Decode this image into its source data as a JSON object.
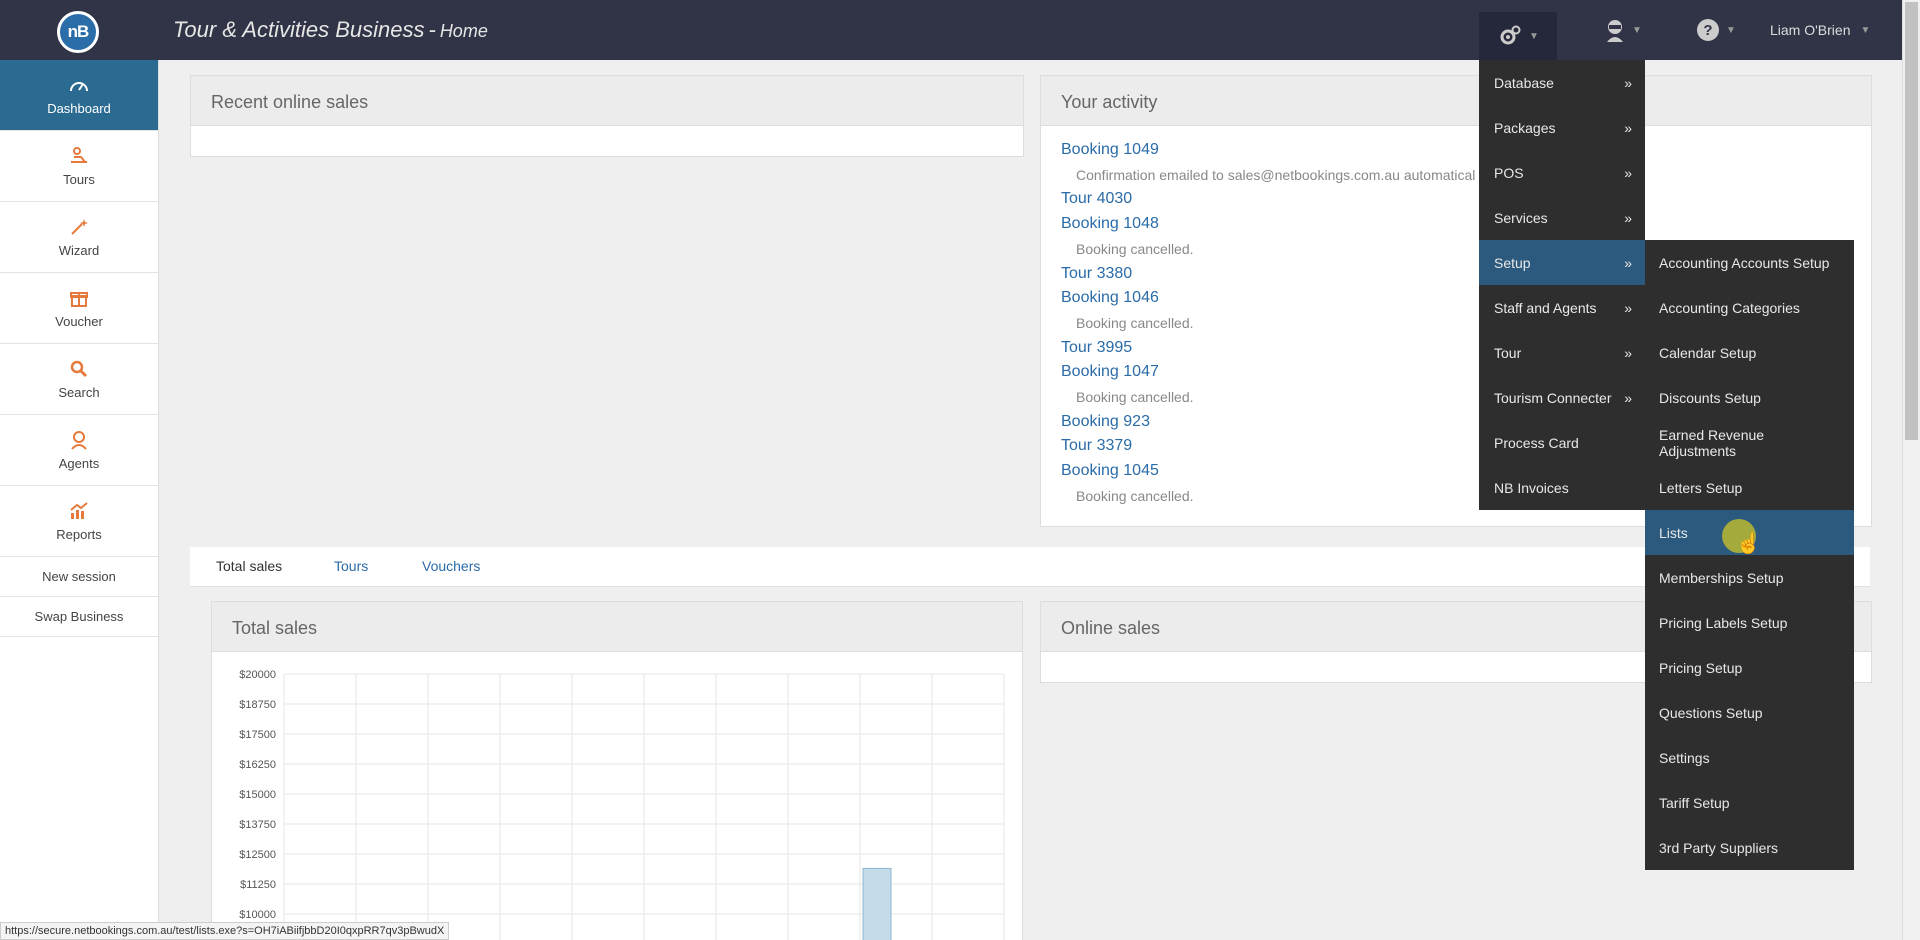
{
  "app": {
    "title": "Tour & Activities Business",
    "separator": "-",
    "page": "Home",
    "logo_text": "nB",
    "user_name": "Liam O'Brien"
  },
  "icons": {
    "gear": "gear-icon",
    "ninja": "ninja-icon",
    "help": "question-icon"
  },
  "sidebar": {
    "items": [
      {
        "label": "Dashboard",
        "icon": "gauge-icon"
      },
      {
        "label": "Tours",
        "icon": "tours-icon"
      },
      {
        "label": "Wizard",
        "icon": "wand-icon"
      },
      {
        "label": "Voucher",
        "icon": "gift-icon"
      },
      {
        "label": "Search",
        "icon": "search-icon"
      },
      {
        "label": "Agents",
        "icon": "agent-icon"
      },
      {
        "label": "Reports",
        "icon": "chart-icon"
      }
    ],
    "new_session": "New session",
    "swap_business": "Swap Business"
  },
  "panels": {
    "recent_sales": "Recent online sales",
    "your_activity": "Your activity",
    "total_sales": "Total sales",
    "online_sales": "Online sales"
  },
  "activity": [
    {
      "link": "Booking 1049",
      "note": "Confirmation emailed to sales@netbookings.com.au automatical"
    },
    {
      "link": "Tour 4030"
    },
    {
      "link": "Booking 1048",
      "note": "Booking cancelled."
    },
    {
      "link": "Tour 3380"
    },
    {
      "link": "Booking 1046",
      "note": "Booking cancelled."
    },
    {
      "link": "Tour 3995"
    },
    {
      "link": "Booking 1047",
      "note": "Booking cancelled."
    },
    {
      "link": "Booking 923"
    },
    {
      "link": "Tour 3379"
    },
    {
      "link": "Booking 1045",
      "note": "Booking cancelled."
    }
  ],
  "tabs": [
    "Total sales",
    "Tours",
    "Vouchers"
  ],
  "menu": {
    "main": [
      {
        "label": "Database",
        "arrow": "»"
      },
      {
        "label": "Packages",
        "arrow": "»"
      },
      {
        "label": "POS",
        "arrow": "»"
      },
      {
        "label": "Services",
        "arrow": "»"
      },
      {
        "label": "Setup",
        "arrow": "»"
      },
      {
        "label": "Staff and Agents",
        "arrow": "»"
      },
      {
        "label": "Tour",
        "arrow": "»"
      },
      {
        "label": "Tourism Connecter",
        "arrow": "»"
      },
      {
        "label": "Process Card",
        "arrow": ""
      },
      {
        "label": "NB Invoices",
        "arrow": ""
      }
    ],
    "setup_sub": [
      "Accounting Accounts Setup",
      "Accounting Categories",
      "Calendar Setup",
      "Discounts Setup",
      "Earned Revenue Adjustments",
      "Letters Setup",
      "Lists",
      "Memberships Setup",
      "Pricing Labels Setup",
      "Pricing Setup",
      "Questions Setup",
      "Settings",
      "Tariff Setup",
      "3rd Party Suppliers"
    ]
  },
  "status_url": "https://secure.netbookings.com.au/test/lists.exe?s=OH7iABiifjbbD20I0qxpRR7qv3pBwudX",
  "chart_data": {
    "type": "bar",
    "title": "Total sales",
    "ylabel": "",
    "xlabel": "",
    "ylim": [
      10000,
      20000
    ],
    "yticks": [
      "$20000",
      "$18750",
      "$17500",
      "$16250",
      "$15000",
      "$13750",
      "$12500",
      "$11250",
      "$10000"
    ],
    "ytick_values": [
      20000,
      18750,
      17500,
      16250,
      15000,
      13750,
      12500,
      11250,
      10000
    ],
    "grid": true,
    "series": [
      {
        "values": [
          0,
          0,
          0,
          0,
          0,
          0,
          0,
          0,
          11900,
          0
        ]
      }
    ]
  }
}
